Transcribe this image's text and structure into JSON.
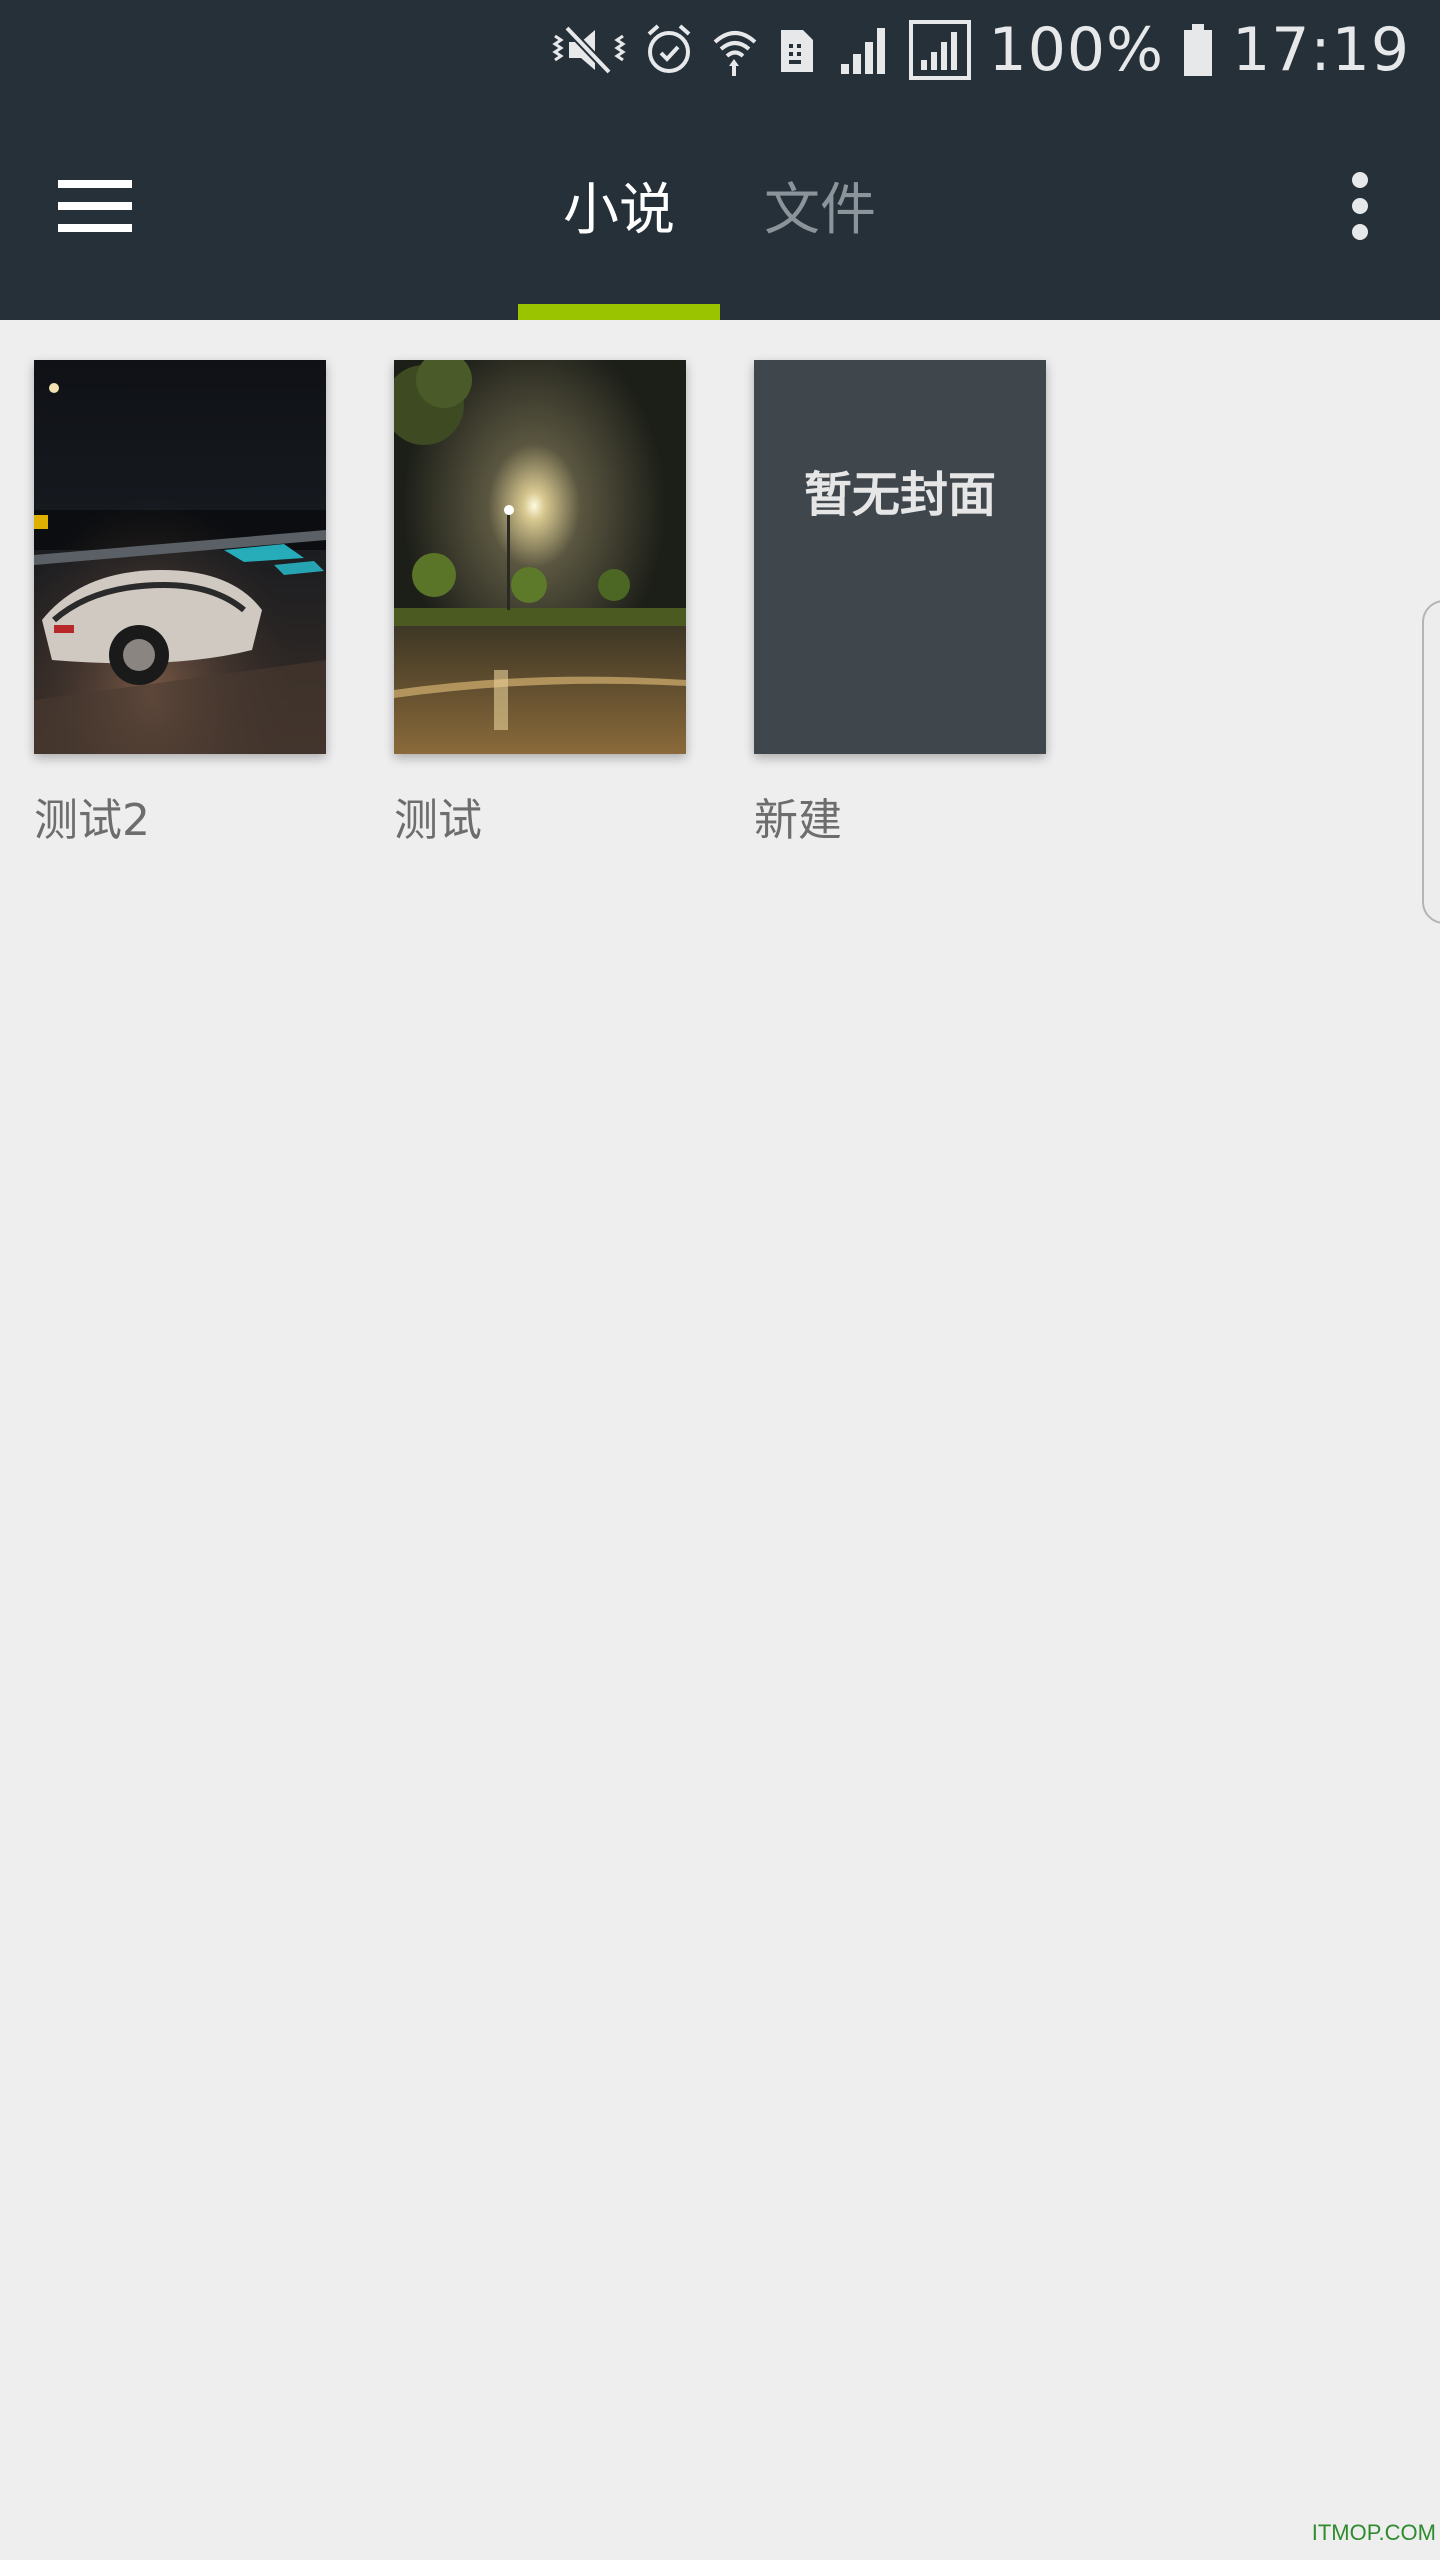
{
  "status_bar": {
    "battery_percent": "100%",
    "time": "17:19",
    "icons": [
      "vibrate-icon",
      "alarm-icon",
      "wifi-icon",
      "sim-icon",
      "signal-icon",
      "signal-box-icon",
      "battery-icon"
    ]
  },
  "app_bar": {
    "tabs": [
      {
        "label": "小说",
        "active": true
      },
      {
        "label": "文件",
        "active": false
      }
    ],
    "accent_color": "#9bc400",
    "background_color": "#263038"
  },
  "books": [
    {
      "title": "测试2",
      "cover": "night-car-photo"
    },
    {
      "title": "测试",
      "cover": "night-streetlight-photo"
    },
    {
      "title": "新建",
      "cover": "none",
      "placeholder": "暂无封面"
    }
  ],
  "watermark": "ITMOP.COM"
}
